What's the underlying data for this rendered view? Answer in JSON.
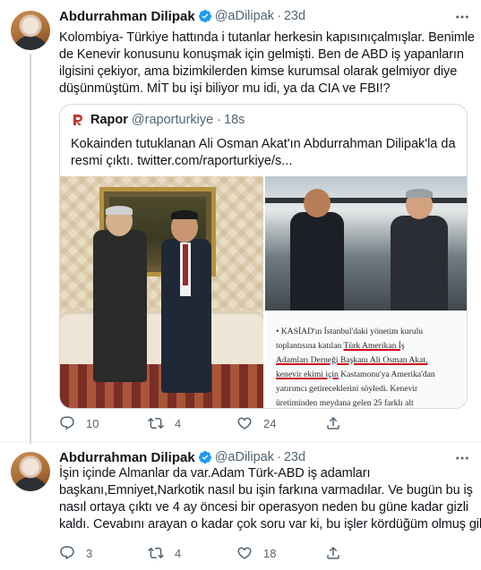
{
  "tweet1": {
    "author_name": "Abdurrahman Dilipak",
    "handle": "@aDilipak",
    "time": "23d",
    "text_lines": [
      "Kolombiya- Türkiye hattında i tutanlar herkesin kapısınıçalmışlar. Benimle",
      "de Kenevir konusunu konuşmak için gelmişti. Ben de ABD iş yapanların",
      "ilgisini çekiyor, ama bizimkilerden kimse kurumsal olarak gelmiyor diye",
      "düşünmüştüm. MİT bu işi biliyor mu idi, ya da CIA ve FBI!?"
    ],
    "quote": {
      "name": "Rapor",
      "handle": "@raporturkiye",
      "time": "18s",
      "text_lines": [
        "Kokainden tutuklanan Ali Osman Akat'ın Abdurrahman Dilipak'la da",
        "resmi çıktı.  twitter.com/raporturkiye/s..."
      ],
      "news_excerpt": {
        "lines": [
          [
            "• KASİAD'ın İstanbul'daki yönetim kurulu",
            ""
          ],
          [
            "  toplantısına katılan ",
            "Türk Amerikan İş"
          ],
          [
            "  ",
            "Adamları Derneği Başkanı Ali Osman Akat,"
          ],
          [
            "  ",
            "kenevir ekimi için"
          ],
          [
            "  yatırımcı getireceklerini söyledi. Kenevir",
            ""
          ],
          [
            "  üretiminden meydana gelen 25 farklı alt",
            ""
          ]
        ],
        "line4_tail": " Kastamonu'ya Amerika'dan"
      }
    },
    "actions": {
      "replies": "10",
      "retweets": "4",
      "likes": "24"
    }
  },
  "tweet2": {
    "author_name": "Abdurrahman Dilipak",
    "handle": "@aDilipak",
    "time": "23d",
    "text_lines": [
      "İşin içinde Almanlar da var.Adam Türk-ABD iş adamları",
      "başkanı,Emniyet,Narkotik nasıl bu işin farkına varmadılar. Ve bugün bu iş",
      "nasıl ortaya çıktı ve 4 ay öncesi bir operasyon neden bu güne kadar gizli",
      "kaldı. Cevabını arayan o kadar çok soru var ki, bu işler kördüğüm olmuş gibi"
    ],
    "actions": {
      "replies": "3",
      "retweets": "4",
      "likes": "18"
    }
  },
  "colors": {
    "verified": "#1d9bf0",
    "secondary_text": "#536471",
    "border": "#cfd9de",
    "news_underline": "#d0021b",
    "rapor_logo": "#c0392b"
  },
  "icons": [
    "more-icon",
    "verified-icon",
    "reply-icon",
    "retweet-icon",
    "like-icon",
    "share-icon",
    "rapor-logo-icon"
  ]
}
